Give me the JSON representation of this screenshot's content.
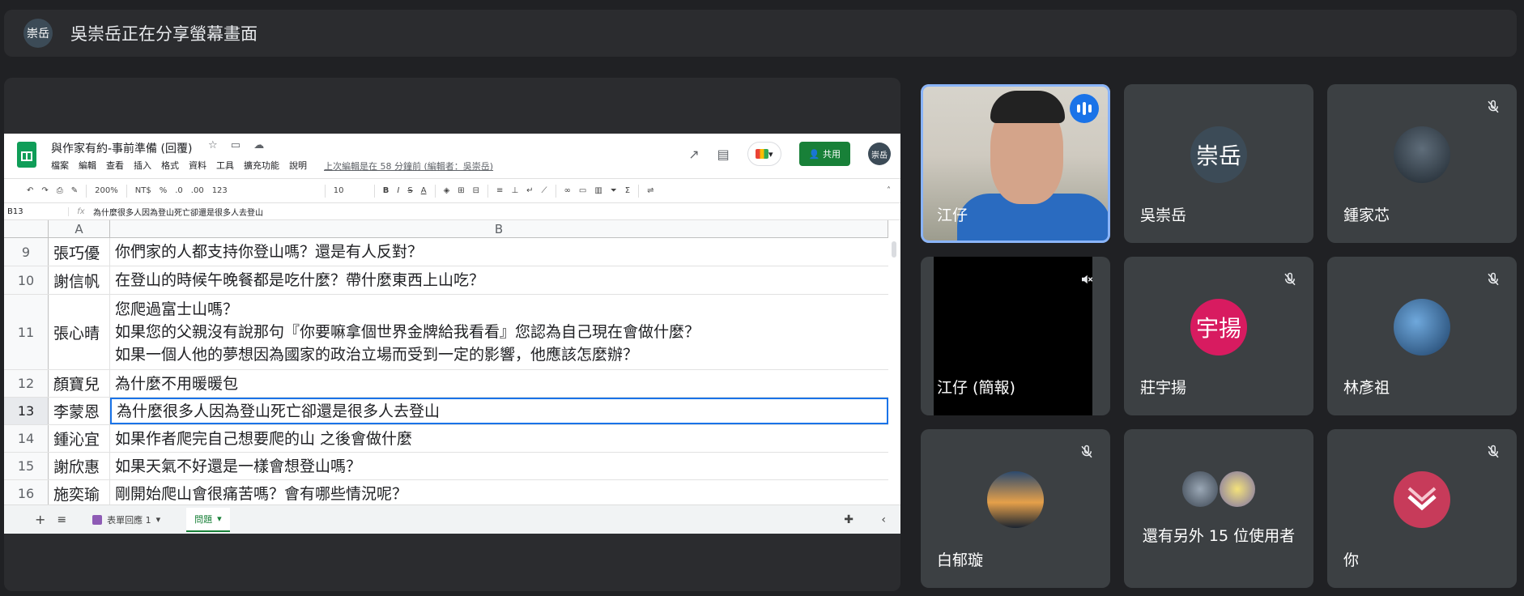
{
  "banner": {
    "avatar": "崇岳",
    "text": "吳崇岳正在分享螢幕畫面"
  },
  "sheet": {
    "title": "與作家有約-事前準備 (回覆)",
    "title_icons": "☆ ▭ ☁",
    "menu": [
      "檔案",
      "編輯",
      "查看",
      "插入",
      "格式",
      "資料",
      "工具",
      "擴充功能",
      "說明"
    ],
    "last_edit": "上次編輯是在 58 分鐘前 (編輯者：吳崇岳)",
    "share_label": "共用",
    "avatar": "崇岳",
    "toolbar": {
      "zoom": "200%",
      "currency": "NT$",
      "percent": "%",
      "dec_less": ".0",
      "dec_more": ".00",
      "format": "123",
      "font_size": "10",
      "bold": "B",
      "italic": "I",
      "strike": "S",
      "text_color": "A"
    },
    "cell_ref": "B13",
    "fx": "fx",
    "formula": "為什麼很多人因為登山死亡卻還是很多人去登山",
    "columns": [
      "A",
      "B"
    ],
    "rows": [
      {
        "num": "9",
        "a": "張巧優",
        "b": [
          "你們家的人都支持你登山嗎？還是有人反對？"
        ]
      },
      {
        "num": "10",
        "a": "謝信帆",
        "b": [
          "在登山的時候午晚餐都是吃什麼？帶什麼東西上山吃？"
        ]
      },
      {
        "num": "11",
        "a": "張心晴",
        "b": [
          "您爬過富士山嗎？",
          "如果您的父親沒有說那句『你要嘛拿個世界金牌給我看看』您認為自己現在會做什麼？",
          "如果一個人他的夢想因為國家的政治立場而受到一定的影響，他應該怎麼辦？"
        ]
      },
      {
        "num": "12",
        "a": "顏寶兒",
        "b": [
          "為什麼不用暖暖包"
        ]
      },
      {
        "num": "13",
        "a": "李蒙恩",
        "b": [
          "為什麼很多人因為登山死亡卻還是很多人去登山"
        ]
      },
      {
        "num": "14",
        "a": "鍾沁宜",
        "b": [
          "如果作者爬完自己想要爬的山 之後會做什麼"
        ]
      },
      {
        "num": "15",
        "a": "謝欣惠",
        "b": [
          "如果天氣不好還是一樣會想登山嗎？"
        ]
      },
      {
        "num": "16",
        "a": "施奕瑜",
        "b": [
          "剛開始爬山會很痛苦嗎？會有哪些情況呢？"
        ]
      }
    ],
    "tabs": [
      {
        "label": "表單回應 1"
      },
      {
        "label": "問題"
      }
    ]
  },
  "participants": [
    {
      "name": "江仔"
    },
    {
      "name": "吳崇岳",
      "avatar": "崇岳"
    },
    {
      "name": "鍾家芯"
    },
    {
      "name": "江仔 (簡報)"
    },
    {
      "name": "莊宇揚",
      "avatar": "宇揚"
    },
    {
      "name": "林彥祖"
    },
    {
      "name": "白郁璇"
    },
    {
      "name": "還有另外 15 位使用者"
    },
    {
      "name": "你"
    }
  ],
  "colors": {
    "background": "#202124",
    "tile": "#3c4043",
    "accent": "#1a73e8",
    "sheets_green": "#188038",
    "avatar_pink": "#d81b60"
  }
}
